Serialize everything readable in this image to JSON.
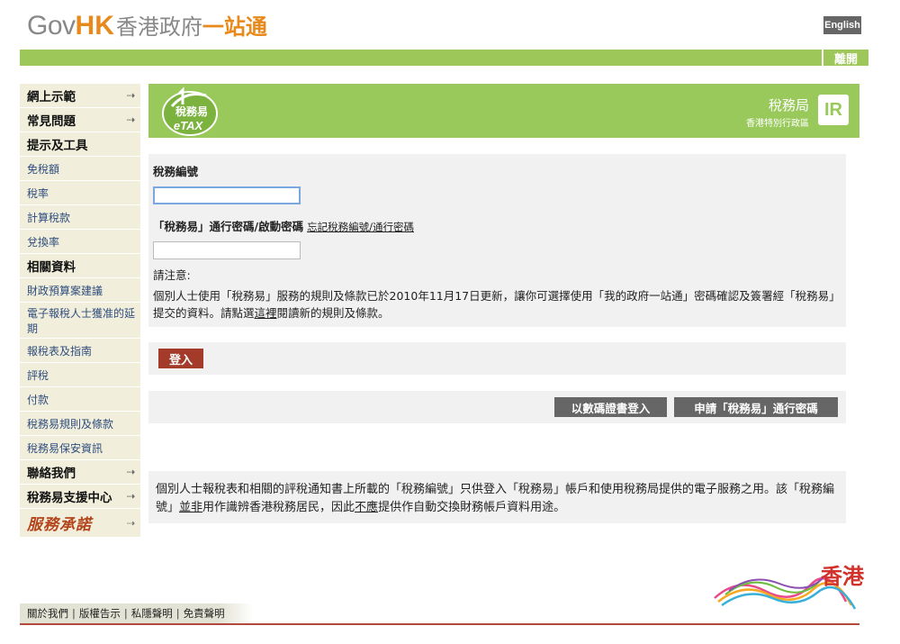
{
  "header": {
    "logo_gov": "Gov",
    "logo_hk": "HK",
    "logo_zh": "香港政府",
    "logo_zh2": "一站通",
    "english_label": "English",
    "logout_label": "離開"
  },
  "sidebar": {
    "items": [
      {
        "label": "網上示範",
        "type": "head",
        "arrow": true
      },
      {
        "label": "常見問題",
        "type": "head",
        "arrow": true
      },
      {
        "label": "提示及工具",
        "type": "head",
        "arrow": false
      },
      {
        "label": "免稅額",
        "type": "link"
      },
      {
        "label": "稅率",
        "type": "link"
      },
      {
        "label": "計算稅款",
        "type": "link"
      },
      {
        "label": "兌換率",
        "type": "link"
      },
      {
        "label": "相關資料",
        "type": "head",
        "arrow": false
      },
      {
        "label": "財政預算案建議",
        "type": "link"
      },
      {
        "label": "電子報稅人士獲准的延期",
        "type": "link-tall"
      },
      {
        "label": "報稅表及指南",
        "type": "link"
      },
      {
        "label": "評稅",
        "type": "link"
      },
      {
        "label": "付款",
        "type": "link"
      },
      {
        "label": "稅務易規則及條款",
        "type": "link"
      },
      {
        "label": "稅務易保安資訊",
        "type": "link"
      },
      {
        "label": "聯絡我們",
        "type": "head",
        "arrow": true
      },
      {
        "label": "稅務易支援中心",
        "type": "head",
        "arrow": true
      },
      {
        "label": "服務承諾",
        "type": "brand",
        "arrow": true
      }
    ],
    "arrow_glyph": "⇢"
  },
  "banner": {
    "etax_zh": "稅務易",
    "etax_en": "eTAX",
    "ird_name": "稅務局",
    "ird_sub": "香港特別行政區",
    "ird_logo": "IR"
  },
  "form": {
    "tax_file_label": "稅務編號",
    "tax_file_value": "",
    "password_label": "「稅務易」通行密碼/啟動密碼",
    "forgot_link": "忘記稅務編號/通行密碼",
    "password_value": "",
    "notice_title": "請注意:",
    "notice_body_1": "個別人士使用「稅務易」服務的規則及條款已於2010年11月17日更新，讓你可選擇使用「我的政府一站通」密碼確認及簽署經「稅務易」提交的資料。請點選",
    "notice_link": "這裡",
    "notice_body_2": "閱讀新的規則及條款。"
  },
  "login": {
    "login_label": "登入"
  },
  "alt": {
    "cert_login_label": "以數碼證書登入",
    "apply_password_label": "申請「稅務易」通行密碼"
  },
  "info": {
    "text_1": "個別人士報稅表和相關的評稅通知書上所載的「稅務編號」只供登入「稅務易」帳戶和使用稅務局提供的電子服務之用。該「稅務編號」",
    "em_1": "並非",
    "text_2": "用作識辨香港稅務居民，因此",
    "em_2": "不應",
    "text_3": "提供作自動交換財務帳戶資料用途。"
  },
  "footer": {
    "links": [
      "關於我們",
      "版權告示",
      "私隱聲明",
      "免責聲明"
    ],
    "brand_text": "香港"
  },
  "colors": {
    "green": "#99c95b",
    "login_red": "#a33a2a",
    "gov_orange": "#e8891c"
  }
}
